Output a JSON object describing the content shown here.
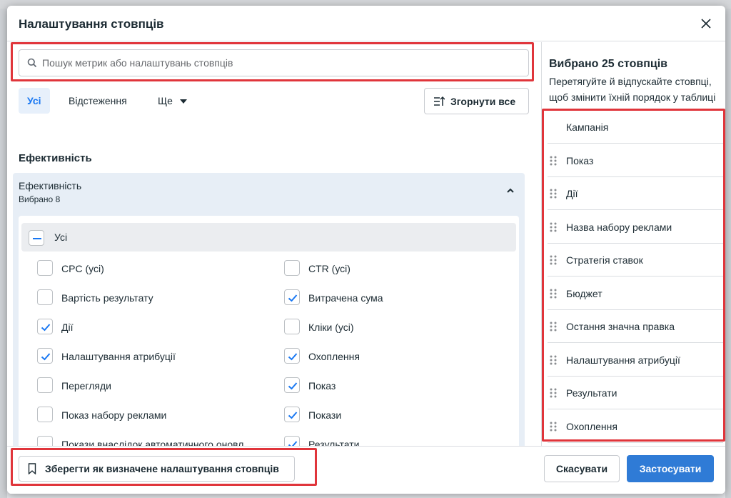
{
  "colors": {
    "accent": "#1877f2",
    "apply_button": "#2f7bd6",
    "highlight": "#e0353b",
    "group_bg": "#e7eef6"
  },
  "dialog": {
    "title": "Налаштування стовпців",
    "close_icon": "close-icon"
  },
  "search": {
    "placeholder": "Пошук метрик або налаштувань стовпців",
    "value": ""
  },
  "tabs": [
    {
      "label": "Усі",
      "active": true
    },
    {
      "label": "Відстеження",
      "active": false
    },
    {
      "label": "Ще",
      "active": false
    }
  ],
  "collapse_all_label": "Згорнути все",
  "section_title": "Ефективність",
  "group": {
    "title": "Ефективність",
    "subtitle": "Вибрано 8",
    "select_all_label": "Усі",
    "options": [
      {
        "label": "CPC (усі)",
        "checked": false
      },
      {
        "label": "CTR (усі)",
        "checked": false
      },
      {
        "label": "Вартість результату",
        "checked": false
      },
      {
        "label": "Витрачена сума",
        "checked": true
      },
      {
        "label": "Дії",
        "checked": true
      },
      {
        "label": "Кліки (усі)",
        "checked": false
      },
      {
        "label": "Налаштування атрибуції",
        "checked": true
      },
      {
        "label": "Охоплення",
        "checked": true
      },
      {
        "label": "Перегляди",
        "checked": false
      },
      {
        "label": "Показ",
        "checked": true
      },
      {
        "label": "Показ набору реклами",
        "checked": false
      },
      {
        "label": "Покази",
        "checked": true
      },
      {
        "label": "Покази внаслідок автоматичного оновл…",
        "checked": false
      },
      {
        "label": "Результати",
        "checked": true
      }
    ]
  },
  "selected_panel": {
    "title": "Вибрано 25 стовпців",
    "description_line1": "Перетягуйте й відпускайте стовпці,",
    "description_line2": "щоб змінити їхній порядок у таблиці",
    "columns": [
      {
        "label": "Кампанія",
        "draggable": false
      },
      {
        "label": "Показ",
        "draggable": true
      },
      {
        "label": "Дії",
        "draggable": true
      },
      {
        "label": "Назва набору реклами",
        "draggable": true
      },
      {
        "label": "Стратегія ставок",
        "draggable": true
      },
      {
        "label": "Бюджет",
        "draggable": true
      },
      {
        "label": "Остання значна правка",
        "draggable": true
      },
      {
        "label": "Налаштування атрибуції",
        "draggable": true
      },
      {
        "label": "Результати",
        "draggable": true
      },
      {
        "label": "Охоплення",
        "draggable": true
      }
    ]
  },
  "footer": {
    "save_preset_label": "Зберегти як визначене налаштування стовпців",
    "cancel_label": "Скасувати",
    "apply_label": "Застосувати"
  }
}
